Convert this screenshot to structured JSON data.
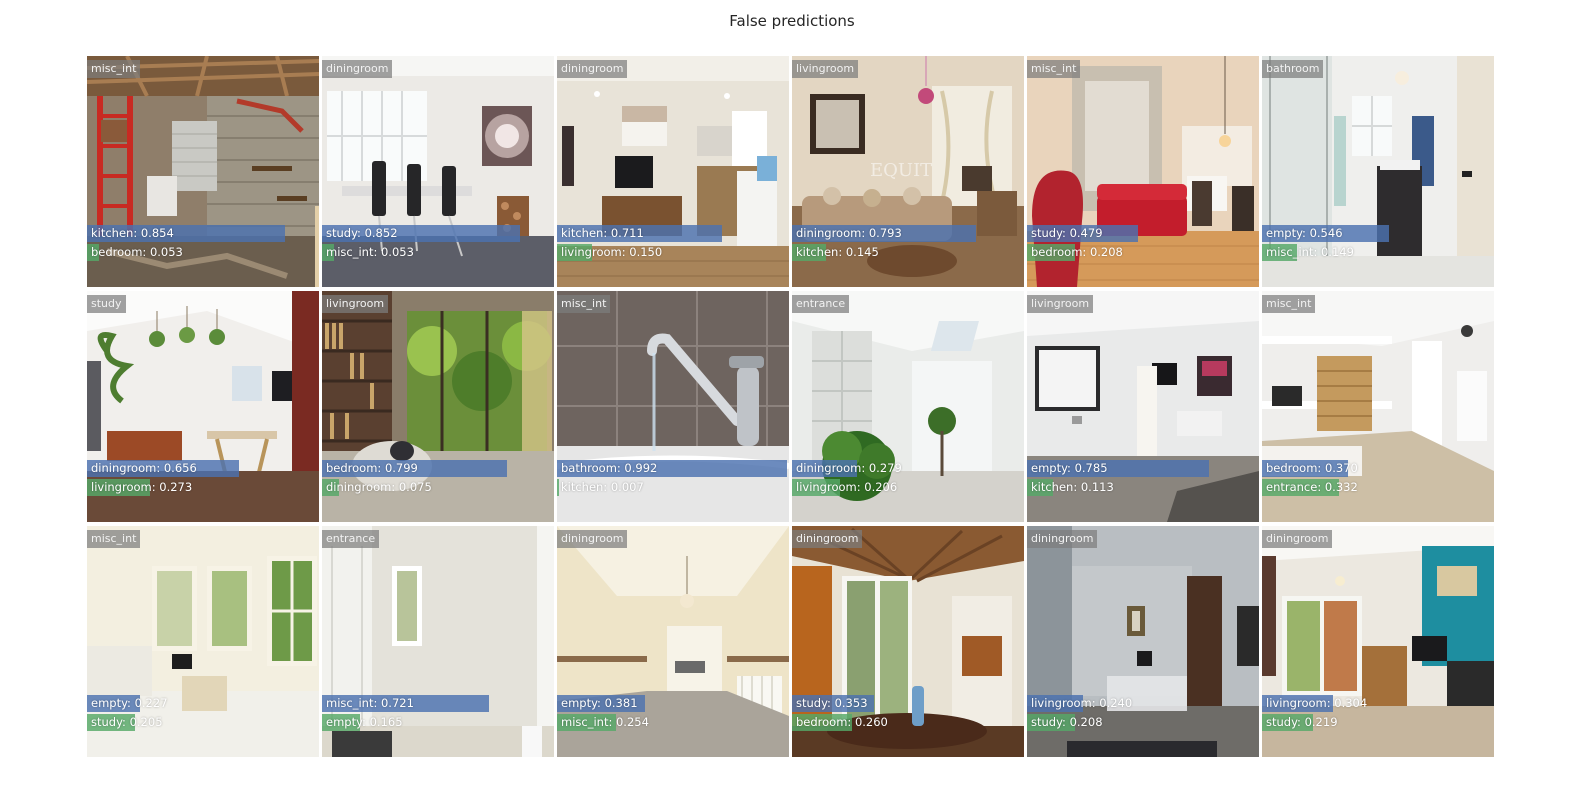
{
  "title": "False predictions",
  "colors": {
    "first_bar": "#4c72b0",
    "second_bar": "#55a868",
    "label_bg": "#7d7d7d"
  },
  "tiles": [
    {
      "true_label": "misc_int",
      "p1": {
        "label": "kitchen: 0.854",
        "value": 0.854
      },
      "p2": {
        "label": "bedroom: 0.053",
        "value": 0.053
      },
      "scene": "garage"
    },
    {
      "true_label": "diningroom",
      "p1": {
        "label": "study: 0.852",
        "value": 0.852
      },
      "p2": {
        "label": "misc_int: 0.053",
        "value": 0.053
      },
      "scene": "white-dining"
    },
    {
      "true_label": "diningroom",
      "p1": {
        "label": "kitchen: 0.711",
        "value": 0.711
      },
      "p2": {
        "label": "livingroom: 0.150",
        "value": 0.15
      },
      "scene": "kitchen-diner"
    },
    {
      "true_label": "livingroom",
      "p1": {
        "label": "diningroom: 0.793",
        "value": 0.793
      },
      "p2": {
        "label": "kitchen: 0.145",
        "value": 0.145
      },
      "scene": "warm-lounge"
    },
    {
      "true_label": "misc_int",
      "p1": {
        "label": "study: 0.479",
        "value": 0.479
      },
      "p2": {
        "label": "bedroom: 0.208",
        "value": 0.208
      },
      "scene": "red-sofa"
    },
    {
      "true_label": "bathroom",
      "p1": {
        "label": "empty: 0.546",
        "value": 0.546
      },
      "p2": {
        "label": "misc_int: 0.149",
        "value": 0.149
      },
      "scene": "shower"
    },
    {
      "true_label": "study",
      "p1": {
        "label": "diningroom: 0.656",
        "value": 0.656
      },
      "p2": {
        "label": "livingroom: 0.273",
        "value": 0.273
      },
      "scene": "plant-study"
    },
    {
      "true_label": "livingroom",
      "p1": {
        "label": "bedroom: 0.799",
        "value": 0.799
      },
      "p2": {
        "label": "diningroom: 0.075",
        "value": 0.075
      },
      "scene": "bookshelf"
    },
    {
      "true_label": "misc_int",
      "p1": {
        "label": "bathroom: 0.992",
        "value": 0.992
      },
      "p2": {
        "label": "kitchen: 0.007",
        "value": 0.007
      },
      "scene": "tap"
    },
    {
      "true_label": "entrance",
      "p1": {
        "label": "diningroom: 0.279",
        "value": 0.279
      },
      "p2": {
        "label": "livingroom: 0.206",
        "value": 0.206
      },
      "scene": "conservatory"
    },
    {
      "true_label": "livingroom",
      "p1": {
        "label": "empty: 0.785",
        "value": 0.785
      },
      "p2": {
        "label": "kitchen: 0.113",
        "value": 0.113
      },
      "scene": "screen-room"
    },
    {
      "true_label": "misc_int",
      "p1": {
        "label": "bedroom: 0.370",
        "value": 0.37
      },
      "p2": {
        "label": "entrance: 0.332",
        "value": 0.332
      },
      "scene": "hamper"
    },
    {
      "true_label": "misc_int",
      "p1": {
        "label": "empty: 0.227",
        "value": 0.227
      },
      "p2": {
        "label": "study: 0.205",
        "value": 0.205
      },
      "scene": "bay-window"
    },
    {
      "true_label": "entrance",
      "p1": {
        "label": "misc_int: 0.721",
        "value": 0.721
      },
      "p2": {
        "label": "empty: 0.165",
        "value": 0.165
      },
      "scene": "white-door"
    },
    {
      "true_label": "diningroom",
      "p1": {
        "label": "empty: 0.381",
        "value": 0.381
      },
      "p2": {
        "label": "misc_int: 0.254",
        "value": 0.254
      },
      "scene": "cream-hall"
    },
    {
      "true_label": "diningroom",
      "p1": {
        "label": "study: 0.353",
        "value": 0.353
      },
      "p2": {
        "label": "bedroom: 0.260",
        "value": 0.26
      },
      "scene": "wood-ceiling"
    },
    {
      "true_label": "diningroom",
      "p1": {
        "label": "livingroom: 0.240",
        "value": 0.24
      },
      "p2": {
        "label": "study: 0.208",
        "value": 0.208
      },
      "scene": "grey-room"
    },
    {
      "true_label": "diningroom",
      "p1": {
        "label": "livingroom: 0.304",
        "value": 0.304
      },
      "p2": {
        "label": "study: 0.219",
        "value": 0.219
      },
      "scene": "teal-wall"
    }
  ]
}
